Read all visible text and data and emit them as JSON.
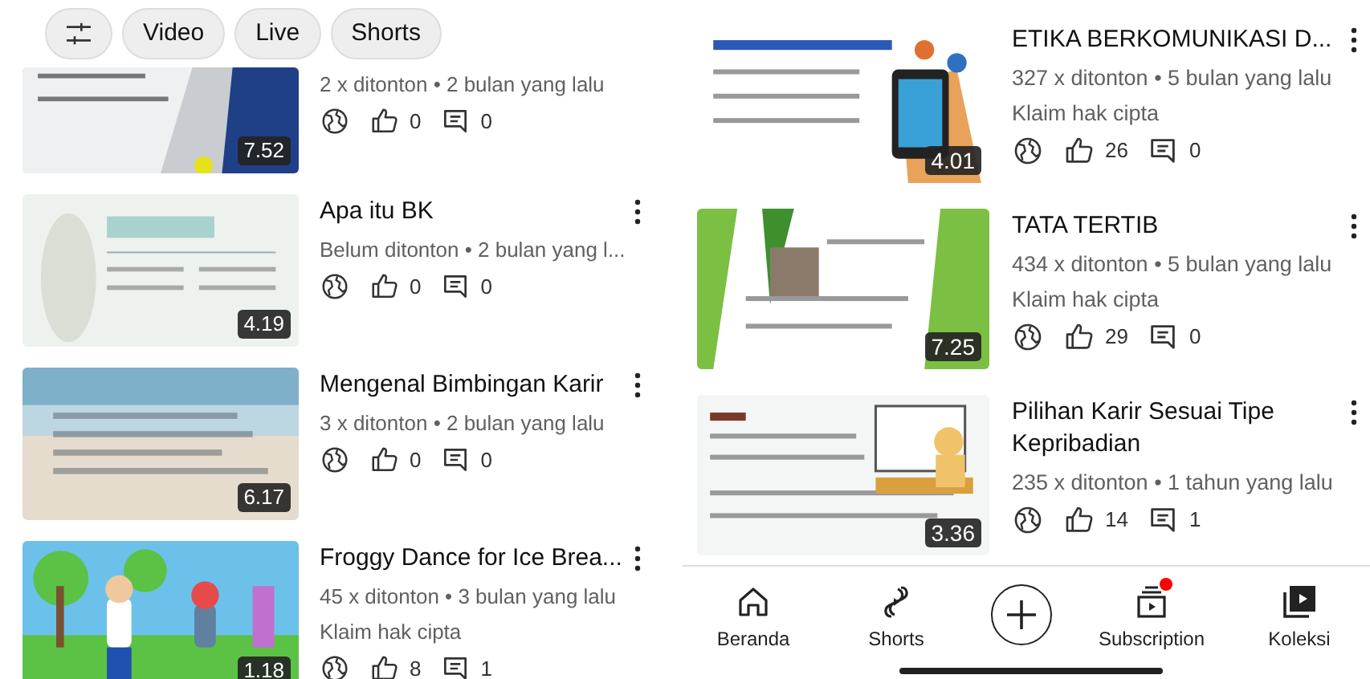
{
  "left_panel": {
    "filters": [
      "Video",
      "Live",
      "Shorts"
    ],
    "videos": [
      {
        "meta": "2 x ditonton • 2 bulan yang lalu",
        "likes": "0",
        "comments": "0",
        "duration": "7.52"
      },
      {
        "title": "Apa itu BK",
        "meta": "Belum ditonton • 2 bulan yang l...",
        "likes": "0",
        "comments": "0",
        "duration": "4.19"
      },
      {
        "title": "Mengenal Bimbingan Karir",
        "meta": "3 x ditonton • 2 bulan yang lalu",
        "likes": "0",
        "comments": "0",
        "duration": "6.17"
      },
      {
        "title": "Froggy Dance for Ice Brea...",
        "meta": "45 x ditonton • 3 bulan yang lalu",
        "claim": "Klaim hak cipta",
        "likes": "8",
        "comments": "1",
        "duration": "1.18"
      }
    ]
  },
  "right_panel": {
    "videos": [
      {
        "title": "ETIKA BERKOMUNIKASI D...",
        "meta": "327 x ditonton • 5 bulan yang lalu",
        "claim": "Klaim hak cipta",
        "likes": "26",
        "comments": "0",
        "duration": "4.01"
      },
      {
        "title": "TATA TERTIB",
        "meta": "434 x ditonton • 5 bulan yang lalu",
        "claim": "Klaim hak cipta",
        "likes": "29",
        "comments": "0",
        "duration": "7.25"
      },
      {
        "title": "Pilihan Karir Sesuai Tipe Kepribadian",
        "meta": "235 x ditonton • 1 tahun yang lalu",
        "likes": "14",
        "comments": "1",
        "duration": "3.36"
      }
    ],
    "nav": [
      {
        "kind": "home",
        "label": "Beranda",
        "notification": false
      },
      {
        "kind": "shorts",
        "label": "Shorts",
        "notification": false
      },
      {
        "kind": "create"
      },
      {
        "kind": "subscriptions",
        "label": "Subscription",
        "notification": true
      },
      {
        "kind": "library",
        "label": "Koleksi",
        "notification": false
      }
    ]
  }
}
